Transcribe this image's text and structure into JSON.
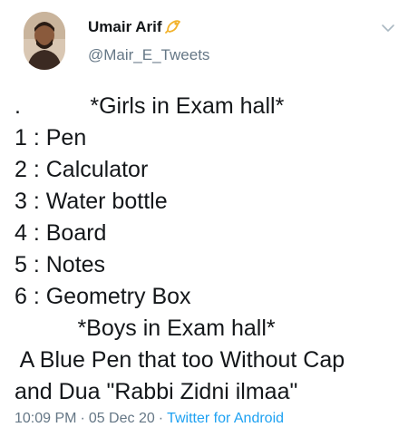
{
  "tweet": {
    "author": {
      "name": "Umair Arif",
      "handle": "@Mair_E_Tweets"
    },
    "badge_color": "#f2b22b",
    "lines": [
      ".           *Girls in Exam hall*",
      "1 : Pen",
      "2 : Calculator",
      "3 : Water bottle",
      "4 : Board",
      "5 : Notes",
      "6 : Geometry Box",
      "          *Boys in Exam hall*",
      " A Blue Pen that too Without Cap",
      "and Dua \"Rabbi Zidni ilmaa\""
    ],
    "time": "10:09 PM",
    "date": "05 Dec 20",
    "separator": "·",
    "source": "Twitter for Android"
  },
  "colors": {
    "text": "#14171a",
    "secondary": "#657786",
    "link": "#1da1f2"
  }
}
